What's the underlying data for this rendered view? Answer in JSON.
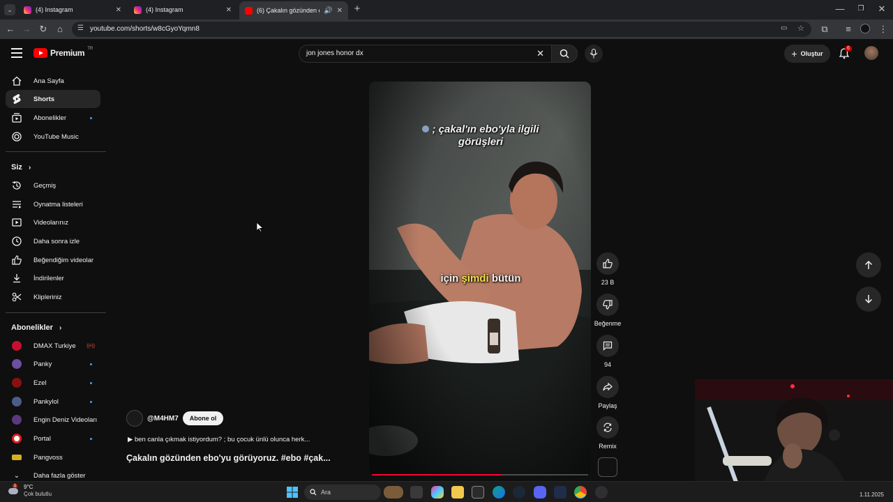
{
  "browser": {
    "tabs": [
      {
        "title": "(4) Instagram",
        "active": false
      },
      {
        "title": "(4) Instagram",
        "active": false
      },
      {
        "title": "(6) Çakalın gözünden ebo'y",
        "active": true
      }
    ],
    "url": "youtube.com/shorts/w8cGyoYqmn8"
  },
  "header": {
    "logo_text": "Premium",
    "logo_region": "TR",
    "search_value": "jon jones honor dx",
    "create_label": "Oluştur",
    "notification_count": "6"
  },
  "sidebar": {
    "main": [
      {
        "label": "Ana Sayfa",
        "icon": "home-icon"
      },
      {
        "label": "Shorts",
        "icon": "shorts-icon",
        "active": true
      },
      {
        "label": "Abonelikler",
        "icon": "subscriptions-icon",
        "dot": true
      },
      {
        "label": "YouTube Music",
        "icon": "music-icon"
      }
    ],
    "you_title": "Siz",
    "you": [
      {
        "label": "Geçmiş",
        "icon": "history-icon"
      },
      {
        "label": "Oynatma listeleri",
        "icon": "playlist-icon"
      },
      {
        "label": "Videolarınız",
        "icon": "your-videos-icon"
      },
      {
        "label": "Daha sonra izle",
        "icon": "watch-later-icon"
      },
      {
        "label": "Beğendiğim videolar",
        "icon": "liked-icon"
      },
      {
        "label": "İndirilenler",
        "icon": "download-icon"
      },
      {
        "label": "Klipleriniz",
        "icon": "clips-icon"
      }
    ],
    "subs_title": "Abonelikler",
    "subs": [
      {
        "label": "DMAX Turkiye",
        "color": "#c8102e",
        "live": true
      },
      {
        "label": "Panky",
        "color": "#6b4fa0",
        "dot": true
      },
      {
        "label": "Ezel",
        "color": "#8a1010",
        "dot": true
      },
      {
        "label": "Pankylol",
        "color": "#4a5d8a",
        "dot": true
      },
      {
        "label": "Engin Deniz Videoları",
        "color": "#5a3a7a"
      },
      {
        "label": "Portal",
        "color": "#e02020",
        "dot": true
      },
      {
        "label": "Pangvoss",
        "color": "#d4b020"
      }
    ],
    "show_more": "Daha fazla göster"
  },
  "video": {
    "caption_top": "; çakal'ın ebo'yla ilgili görüşleri",
    "caption_mid_1": "için",
    "caption_mid_2": "şimdi",
    "caption_mid_3": "bütün",
    "channel": "@M4HM7",
    "subscribe_label": "Abone ol",
    "description": "▶ ben canla çıkmak istiyordum? ; bu çocuk ünlü olunca herk...",
    "title": "Çakalın gözünden ebo'yu görüyoruz. #ebo #çak...",
    "progress": 0.6
  },
  "actions": {
    "like_count": "23 B",
    "dislike_label": "Beğenme",
    "comment_count": "94",
    "share_label": "Paylaş",
    "remix_label": "Remix"
  },
  "taskbar": {
    "weather_temp": "9°C",
    "weather_text": "Çok bulutlu",
    "weather_badge": "1",
    "search_placeholder": "Ara",
    "date": "1.11.2025"
  }
}
